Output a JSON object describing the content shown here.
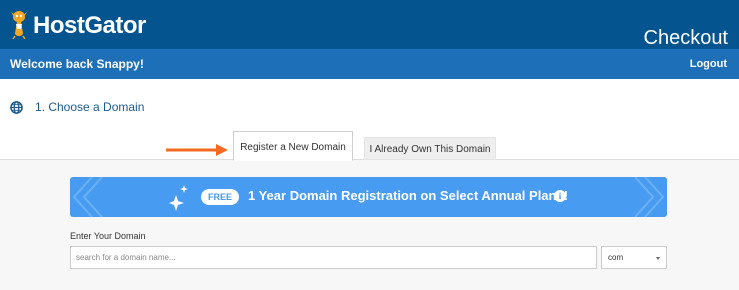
{
  "header": {
    "brand": "HostGator",
    "page_title": "Checkout"
  },
  "welcome_bar": {
    "welcome_text": "Welcome back Snappy!",
    "logout_label": "Logout"
  },
  "section": {
    "title": "1. Choose a Domain",
    "icon": "globe-icon"
  },
  "tabs": [
    {
      "label": "Register a New Domain",
      "active": true
    },
    {
      "label": "I Already Own This Domain",
      "active": false
    }
  ],
  "promo": {
    "badge": "FREE",
    "text": "1 Year Domain Registration on Select Annual Plans!",
    "info_glyph": "i"
  },
  "domain_form": {
    "label": "Enter Your Domain",
    "placeholder": "search for a domain name...",
    "value": "",
    "tld_selected": "com"
  },
  "colors": {
    "header_bg": "#03548f",
    "welcome_bg": "#1d6fb7",
    "promo_bg": "#479bf0",
    "arrow": "#f26b21",
    "section_title": "#1a5a8c"
  }
}
